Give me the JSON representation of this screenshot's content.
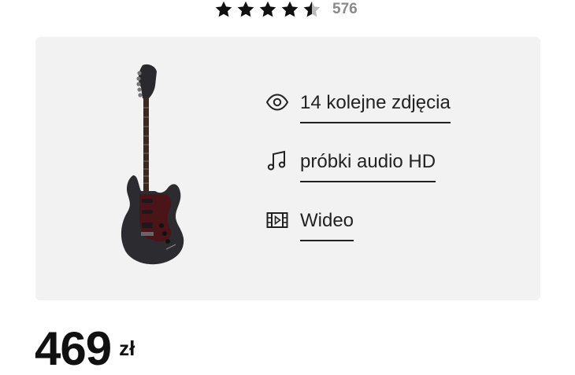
{
  "rating": {
    "stars": 4.5,
    "count": "576"
  },
  "media": {
    "items": [
      {
        "label": "14 kolejne zdjęcia",
        "icon": "eye-icon"
      },
      {
        "label": "próbki audio HD",
        "icon": "music-note-icon"
      },
      {
        "label": "Wideo",
        "icon": "video-icon"
      }
    ]
  },
  "price": {
    "value": "469",
    "currency": "zł"
  },
  "colors": {
    "card_bg": "#f2f2f2",
    "star_filled": "#111111",
    "star_empty": "#bbbbbb",
    "text": "#222222"
  }
}
